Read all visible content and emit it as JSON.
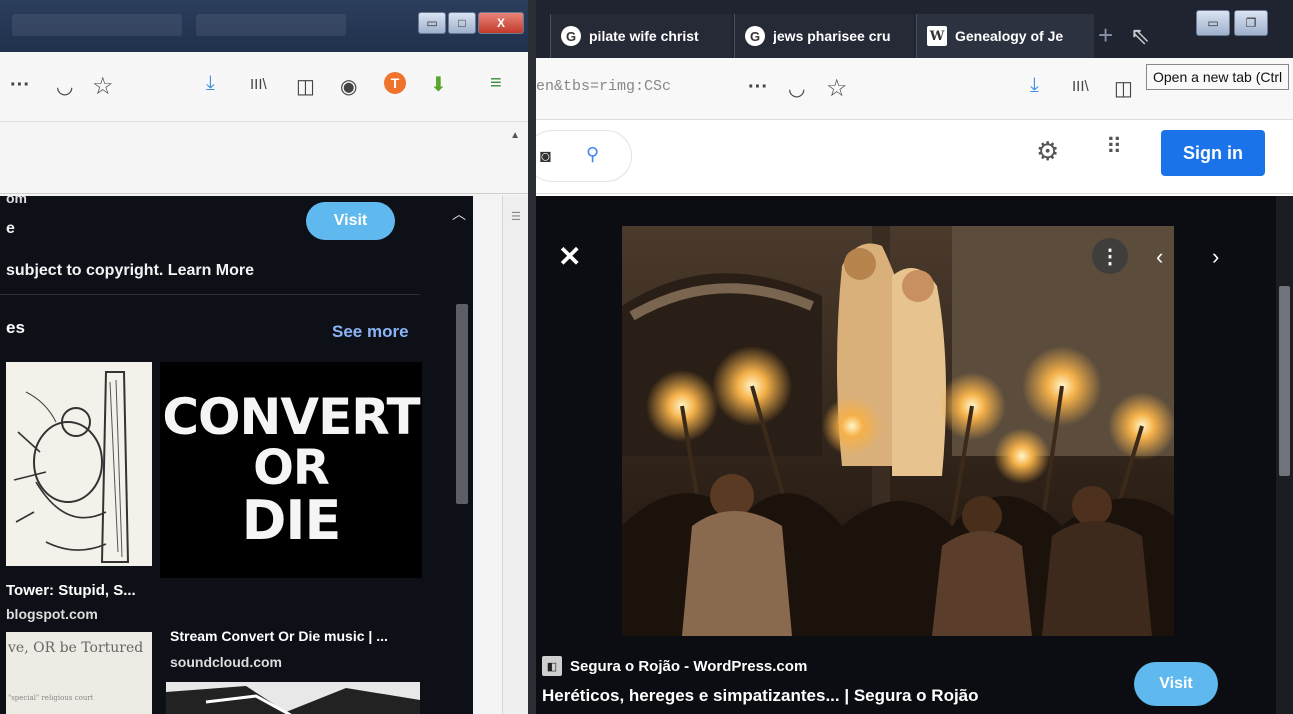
{
  "left_window": {
    "window_controls": {
      "minimize": "▭",
      "maximize": "□",
      "close": "X"
    },
    "toolbar_icons": [
      "more-dots",
      "pocket",
      "bookmark-star",
      "download",
      "library",
      "sidebar",
      "account",
      "extension",
      "update"
    ],
    "toolbar": {
      "dots": "···",
      "pocket": "◡",
      "star": "☆",
      "download": "⤓",
      "library": "III\\",
      "sidebar": "◫",
      "account": "◉",
      "ext": "T",
      "ext2": "⬇",
      "menu": "≡"
    },
    "panel": {
      "title_fragment": "om",
      "site_fragment": "e",
      "visit_label": "Visit",
      "copyright_notice": "subject to copyright. Learn More",
      "related_heading_fragment": "es",
      "see_more_label": "See more",
      "result_1": {
        "title": "Tower: Stupid, S...",
        "site": "blogspot.com"
      },
      "result_2": {
        "title": "Stream Convert Or Die music | ...",
        "site": "soundcloud.com",
        "image_text": [
          "CONVERT",
          "OR",
          "DIE"
        ]
      },
      "result_3": {
        "image_text": "ve, OR be Tortured",
        "image_small_text": "\"special\" religious court"
      }
    }
  },
  "right_window": {
    "tabs": [
      {
        "favicon": "G",
        "label": "pilate wife christ"
      },
      {
        "favicon": "G",
        "label": "jews pharisee cru"
      },
      {
        "favicon": "W",
        "label": "Genealogy of Je"
      }
    ],
    "new_tab_symbol": "+",
    "cursor_symbol": "⇖",
    "window_controls": {
      "minimize": "▭",
      "restore": "❐"
    },
    "url_fragment": "en&tbs=rimg:CSc",
    "tooltip": "Open a new tab (Ctrl",
    "toolbar": {
      "dots": "···",
      "pocket": "◡",
      "star": "☆",
      "download": "⤓",
      "library": "III\\",
      "sidebar": "◫"
    },
    "google_bar": {
      "camera_icon": "◙",
      "search_icon": "⚲",
      "gear_icon": "⚙",
      "apps_icon": "⠿",
      "sign_in_label": "Sign in"
    },
    "viewer": {
      "close_symbol": "✕",
      "more_symbol": "⋮",
      "prev_symbol": "‹",
      "next_symbol": "›",
      "source_favicon": "◧",
      "source_name": "Segura o Rojão - WordPress.com",
      "image_title": "Heréticos, hereges e simpatizantes... | Segura o Rojão",
      "visit_label": "Visit"
    }
  },
  "colors": {
    "visit_button": "#5fb8ee",
    "sign_in_button": "#1a73e8",
    "see_more_link": "#8ab4f8",
    "dark_panel": "#0d1117"
  }
}
